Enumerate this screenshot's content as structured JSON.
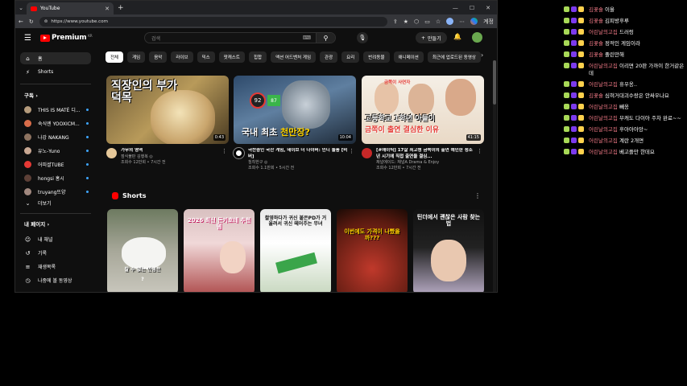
{
  "browser": {
    "tab_title": "YouTube",
    "url": "https://www.youtube.com",
    "profile_label": "계정"
  },
  "youtube": {
    "logo_text": "Premium",
    "logo_sup": "KR",
    "search_placeholder": "검색",
    "create_label": "만들기",
    "sidebar": {
      "home": "홈",
      "shorts": "Shorts",
      "subscriptions_head": "구독",
      "subs": [
        {
          "label": "THIS IS MATÉ 디...",
          "color": "#b59b7c"
        },
        {
          "label": "숙식엔 YOOXICM...",
          "color": "#d96d4a"
        },
        {
          "label": "나강 NAKANG",
          "color": "#8e7360"
        },
        {
          "label": "유노-Yuno",
          "color": "#c9a893"
        },
        {
          "label": "어피셜TUBE",
          "color": "#e53935"
        },
        {
          "label": "hongsi 홍시",
          "color": "#5d4037"
        },
        {
          "label": "truyang뜨양",
          "color": "#a1887f"
        }
      ],
      "more": "더보기",
      "my_page_head": "내 페이지",
      "my_channel": "내 채널",
      "history": "기록",
      "playlists": "재생목록",
      "watch_later": "나중에 볼 동영상"
    },
    "chips": [
      "전체",
      "게임",
      "음악",
      "라이브",
      "믹스",
      "팟캐스트",
      "힙합",
      "액션 어드벤처 게임",
      "관광",
      "요리",
      "반려동물",
      "애니메이션",
      "최근에 업로드된 동영상"
    ],
    "videos": [
      {
        "thumb_text": "직장인의 부가 덕목",
        "duration": "0:43",
        "title": "가무의 영역",
        "channel": "점식불판 김행복 ◎",
        "stats": "조회수 12만회 • 7시간 전"
      },
      {
        "thumb_text_white": "국내 최초",
        "thumb_text_yellow": "천만장?",
        "duration": "10:04",
        "badge1": "92",
        "badge2": "87",
        "title": "극찬중인 국산 게임, 데이브 더 다이버: 인디 돌풍 [비버]",
        "channel": "침착한구 ◎",
        "stats": "조회수 1.1만회 • 5시간 전"
      },
      {
        "thumb_top": "고등학교 1학년 아들이",
        "thumb_bottom": "금쪽이 출연 결심한 이유",
        "thumb_tag": "금쪽이 사연자",
        "duration": "41:15",
        "title": "[#에이틱] 17살 최고령 금쪽이의 출연 예민한 청소년 시기에 직접 출연을 결심...",
        "channel": "채널에이드: 채널A Drama & Enjoy",
        "stats": "조회수 12만회 • 7시간 전"
      }
    ],
    "shorts_title": "Shorts",
    "shorts": [
      {
        "caption": "잘 수 없는 만큼은",
        "sub": "?"
      },
      {
        "caption": "2026 최신 돈키호테 추천템"
      },
      {
        "caption": "촬영하다가 귀신 붙은PD가 거울려서 귀신 떼어주는 무녀"
      },
      {
        "caption": "이번에도 가격이 나빴을까???"
      },
      {
        "caption": "틴더에서 괜찮은 사람 찾는 법"
      }
    ]
  },
  "chat": [
    {
      "nick": "김꽃숄",
      "text": "이올"
    },
    {
      "nick": "김꽃숄",
      "text": "김피방후루"
    },
    {
      "nick": "어린날의고집",
      "text": "드러렁"
    },
    {
      "nick": "김꽃숄",
      "text": "정적인 게임이라"
    },
    {
      "nick": "김꽃숄",
      "text": "졸린만해"
    },
    {
      "nick": "어린날의고집",
      "text": "이리면 20판 가까이 한거같은데"
    },
    {
      "nick": "어린날의고집",
      "text": "휴우옹.."
    },
    {
      "nick": "김꽃숄",
      "text": "심혀거대괴수랑은 안싸우나요"
    },
    {
      "nick": "어린날의고집",
      "text": "빼옹"
    },
    {
      "nick": "어린날의고집",
      "text": "부캐도 다이아 주차 완료~~"
    },
    {
      "nick": "어린날의고집",
      "text": "후아아아앙~"
    },
    {
      "nick": "어린날의고집",
      "text": "계란 2개면"
    },
    {
      "nick": "어린날의고집",
      "text": "베고플만 한데요"
    }
  ]
}
